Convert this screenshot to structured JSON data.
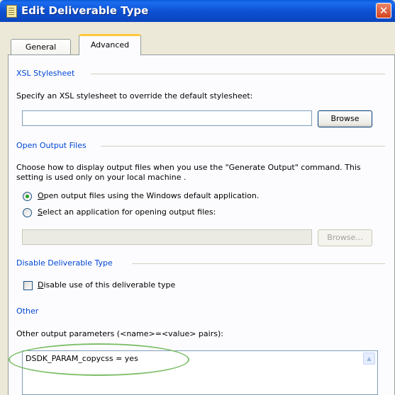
{
  "window": {
    "title": "Edit Deliverable Type",
    "close_glyph": "✕"
  },
  "tabs": [
    {
      "label": "General"
    },
    {
      "label": "Advanced"
    }
  ],
  "xsl": {
    "heading": "XSL Stylesheet",
    "description": "Specify an XSL stylesheet to override the default stylesheet:",
    "input_value": "",
    "browse_label": "Browse"
  },
  "output": {
    "heading": "Open Output Files",
    "description_line1": "Choose how to display output files when you use the \"Generate Output\" command. This",
    "description_line2": "setting is used only on your local machine .",
    "option1_key": "O",
    "option1_rest": "pen output files using the Windows default application.",
    "option2_key": "S",
    "option2_rest": "elect an application for opening output files:",
    "app_path_value": "",
    "browse_label": "Browse..."
  },
  "disable": {
    "heading": "Disable Deliverable Type",
    "checkbox_key": "D",
    "checkbox_rest": "isable use of this deliverable type"
  },
  "other": {
    "heading": "Other",
    "params_label": "Other output parameters (<name>=<value> pairs):",
    "params_value": "DSDK_PARAM_copycss = yes"
  },
  "icons": {
    "title_icon": "document-icon",
    "scroll_up": "▲"
  }
}
